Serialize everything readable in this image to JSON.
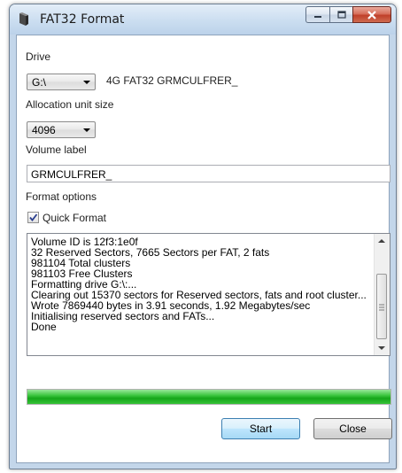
{
  "window": {
    "title": "FAT32 Format",
    "icon": "app-icon"
  },
  "drive": {
    "label": "Drive",
    "selected": "G:\\",
    "description": "4G FAT32 GRMCULFRER_"
  },
  "allocation": {
    "label": "Allocation unit size",
    "selected": "4096"
  },
  "volume": {
    "label": "Volume label",
    "value": "GRMCULFRER_"
  },
  "format_options": {
    "label": "Format options",
    "quick_format_label": "Quick Format",
    "quick_format_checked": true
  },
  "log": {
    "lines": [
      "Volume ID is 12f3:1e0f",
      "32 Reserved Sectors, 7665 Sectors per FAT, 2 fats",
      "981104 Total clusters",
      "981103 Free Clusters",
      "Formatting drive G:\\:...",
      "Clearing out 15370 sectors for Reserved sectors, fats and root cluster...",
      "Wrote 7869440 bytes in 3.91 seconds, 1.92 Megabytes/sec",
      "Initialising reserved sectors and FATs...",
      "Done"
    ]
  },
  "progress": {
    "percent": 100,
    "color": "#22b024"
  },
  "buttons": {
    "start": "Start",
    "close": "Close"
  }
}
